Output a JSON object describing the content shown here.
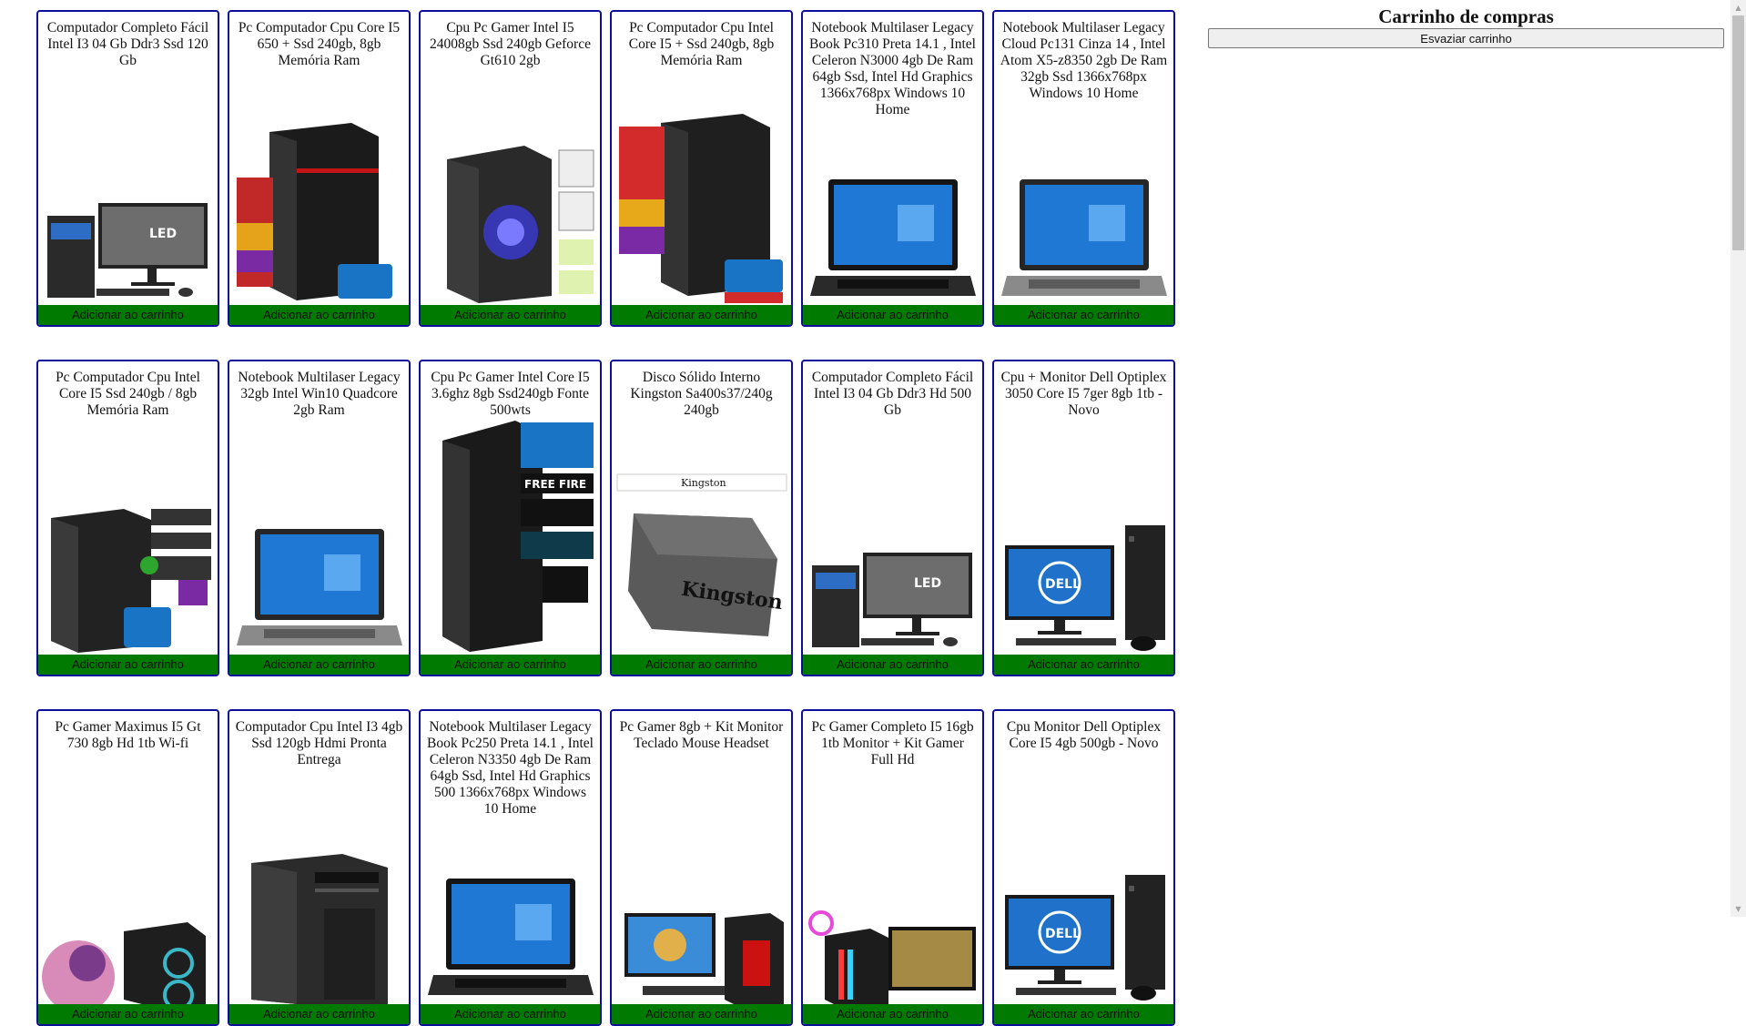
{
  "add_label": "Adicionar ao carrinho",
  "cart": {
    "title": "Carrinho de compras",
    "clear_label": "Esvaziar carrinho"
  },
  "products": [
    {
      "title": "Computador Completo Fácil Intel I3 04 Gb Ddr3 Ssd 120 Gb",
      "image": "desktop-monitor-kit"
    },
    {
      "title": "Pc Computador Cpu Core I5 650 + Ssd 240gb, 8gb Memória Ram",
      "image": "pc-tower-red"
    },
    {
      "title": "Cpu Pc Gamer Intel I5 24008gb Ssd 240gb Geforce Gt610 2gb",
      "image": "pc-tower-gamer-blue"
    },
    {
      "title": "Pc Computador Cpu Intel Core I5 + Ssd 240gb, 8gb Memória Ram",
      "image": "pc-tower-specs"
    },
    {
      "title": "Notebook Multilaser Legacy Book Pc310 Preta 14.1 , Intel Celeron N3000 4gb De Ram 64gb Ssd, Intel Hd Graphics 1366x768px Windows 10 Home",
      "image": "laptop-dark"
    },
    {
      "title": "Notebook Multilaser Legacy Cloud Pc131 Cinza 14 , Intel Atom X5-z8350 2gb De Ram 32gb Ssd 1366x768px Windows 10 Home",
      "image": "laptop-gray"
    },
    {
      "title": "Pc Computador Cpu Intel Core I5 Ssd 240gb / 8gb Memória Ram",
      "image": "pc-tower-badges"
    },
    {
      "title": "Notebook Multilaser Legacy 32gb Intel Win10 Quadcore 2gb Ram",
      "image": "laptop-gray"
    },
    {
      "title": "Cpu Pc Gamer Intel Core I5 3.6ghz 8gb Ssd240gb Fonte 500wts",
      "image": "pc-tower-games"
    },
    {
      "title": "Disco Sólido Interno Kingston Sa400s37/240g 240gb",
      "image": "ssd-kingston"
    },
    {
      "title": "Computador Completo Fácil Intel I3 04 Gb Ddr3 Hd 500 Gb",
      "image": "desktop-monitor-kit"
    },
    {
      "title": "Cpu + Monitor Dell Optiplex 3050 Core I5 7ger 8gb 1tb - Novo",
      "image": "dell-desktop"
    },
    {
      "title": "Pc Gamer Maximus I5 Gt 730 8gb Hd 1tb Wi-fi",
      "image": "pc-gamer-art"
    },
    {
      "title": "Computador Cpu Intel I3 4gb Ssd 120gb Hdmi Pronta Entrega",
      "image": "pc-tower-plain"
    },
    {
      "title": "Notebook Multilaser Legacy Book Pc250 Preta 14.1 , Intel Celeron N3350 4gb De Ram 64gb Ssd, Intel Hd Graphics 500 1366x768px Windows 10 Home",
      "image": "laptop-dark"
    },
    {
      "title": "Pc Gamer 8gb + Kit Monitor Teclado Mouse Headset",
      "image": "pc-gamer-kit"
    },
    {
      "title": "Pc Gamer Completo I5 16gb 1tb Monitor + Kit Gamer Full Hd",
      "image": "pc-gamer-rgb"
    },
    {
      "title": "Cpu Monitor Dell Optiplex Core I5 4gb 500gb - Novo",
      "image": "dell-desktop"
    }
  ]
}
